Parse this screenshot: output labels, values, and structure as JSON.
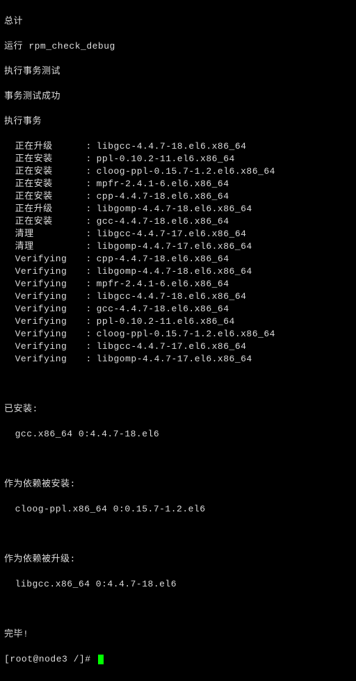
{
  "header": {
    "total": "总计",
    "run_check": "运行 rpm_check_debug",
    "exec_test": "执行事务测试",
    "test_ok": "事务测试成功",
    "exec_trans": "执行事务"
  },
  "transactions": [
    {
      "action": "正在升级",
      "sep": ":",
      "pkg": "libgcc-4.4.7-18.el6.x86_64"
    },
    {
      "action": "正在安装",
      "sep": ":",
      "pkg": "ppl-0.10.2-11.el6.x86_64"
    },
    {
      "action": "正在安装",
      "sep": ":",
      "pkg": "cloog-ppl-0.15.7-1.2.el6.x86_64"
    },
    {
      "action": "正在安装",
      "sep": ":",
      "pkg": "mpfr-2.4.1-6.el6.x86_64"
    },
    {
      "action": "正在安装",
      "sep": ":",
      "pkg": "cpp-4.4.7-18.el6.x86_64"
    },
    {
      "action": "正在升级",
      "sep": ":",
      "pkg": "libgomp-4.4.7-18.el6.x86_64"
    },
    {
      "action": "正在安装",
      "sep": ":",
      "pkg": "gcc-4.4.7-18.el6.x86_64"
    },
    {
      "action": "清理",
      "sep": ":",
      "pkg": "libgcc-4.4.7-17.el6.x86_64"
    },
    {
      "action": "清理",
      "sep": ":",
      "pkg": "libgomp-4.4.7-17.el6.x86_64"
    },
    {
      "action": "Verifying",
      "sep": ":",
      "pkg": "cpp-4.4.7-18.el6.x86_64"
    },
    {
      "action": "Verifying",
      "sep": ":",
      "pkg": "libgomp-4.4.7-18.el6.x86_64"
    },
    {
      "action": "Verifying",
      "sep": ":",
      "pkg": "mpfr-2.4.1-6.el6.x86_64"
    },
    {
      "action": "Verifying",
      "sep": ":",
      "pkg": "libgcc-4.4.7-18.el6.x86_64"
    },
    {
      "action": "Verifying",
      "sep": ":",
      "pkg": "gcc-4.4.7-18.el6.x86_64"
    },
    {
      "action": "Verifying",
      "sep": ":",
      "pkg": "ppl-0.10.2-11.el6.x86_64"
    },
    {
      "action": "Verifying",
      "sep": ":",
      "pkg": "cloog-ppl-0.15.7-1.2.el6.x86_64"
    },
    {
      "action": "Verifying",
      "sep": ":",
      "pkg": "libgcc-4.4.7-17.el6.x86_64"
    },
    {
      "action": "Verifying",
      "sep": ":",
      "pkg": "libgomp-4.4.7-17.el6.x86_64"
    }
  ],
  "sections": {
    "installed_hdr": "已安装:",
    "installed_item": "gcc.x86_64 0:4.4.7-18.el6",
    "dep_installed_hdr": "作为依赖被安装:",
    "dep_installed_item": "cloog-ppl.x86_64 0:0.15.7-1.2.el6",
    "dep_upgraded_hdr": "作为依赖被升级:",
    "dep_upgraded_item": "libgcc.x86_64 0:4.4.7-18.el6",
    "done": "完毕!"
  },
  "prompt": "[root@node3 /]# "
}
